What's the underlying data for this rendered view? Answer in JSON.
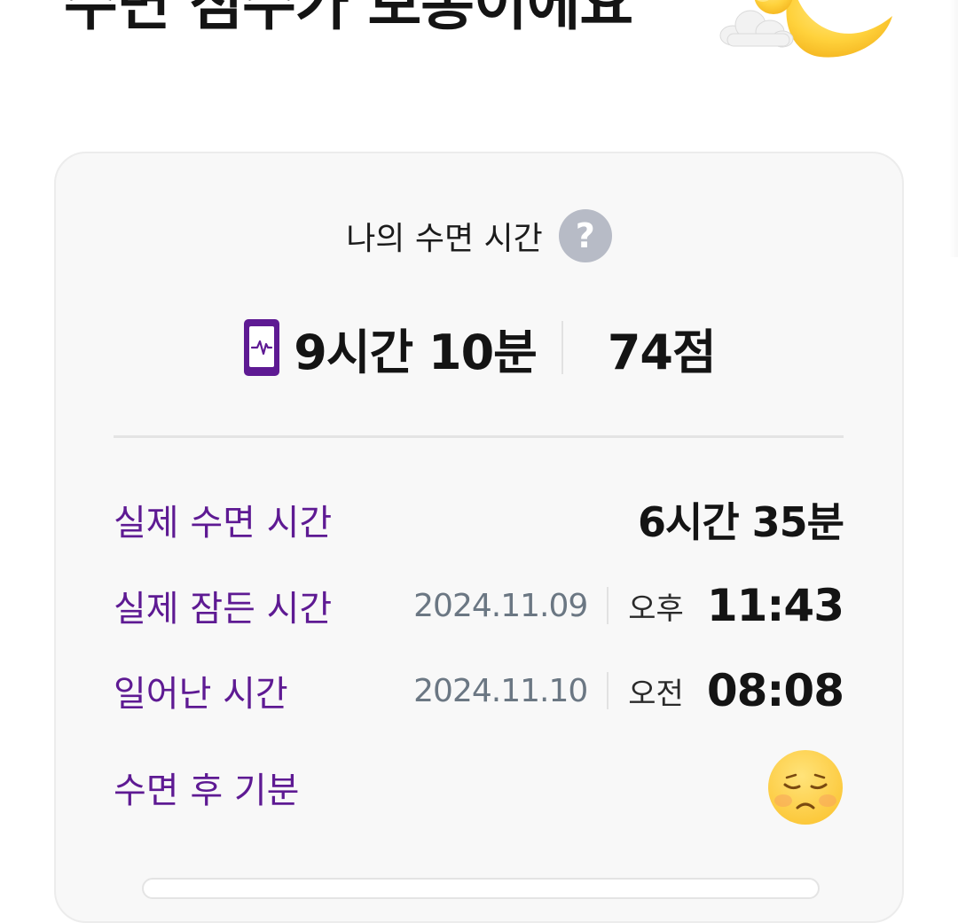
{
  "header": {
    "title": "수면 점수가 보통이에요"
  },
  "sleep_card": {
    "header_label": "나의 수면 시간",
    "summary": {
      "duration": "9시간 10분",
      "score": "74점"
    },
    "rows": {
      "actual_sleep": {
        "label": "실제 수면 시간",
        "value": "6시간 35분"
      },
      "fell_asleep": {
        "label": "실제 잠든 시간",
        "date": "2024.11.09",
        "ampm": "오후",
        "time": "11:43"
      },
      "woke_up": {
        "label": "일어난 시간",
        "date": "2024.11.10",
        "ampm": "오전",
        "time": "08:08"
      },
      "mood": {
        "label": "수면 후 기분"
      }
    }
  },
  "icons": {
    "help": "question-mark-icon",
    "device": "phone-heartbeat-icon",
    "mood": "sleepy-face-emoji-icon",
    "illustration": "moon-with-cloud-icon"
  },
  "colors": {
    "accent_purple": "#5e1a93",
    "card_background": "#f8f8f8",
    "help_icon_gray": "#b7bbc6",
    "date_gray": "#6b7783",
    "moon_yellow": "#ffd23c"
  }
}
